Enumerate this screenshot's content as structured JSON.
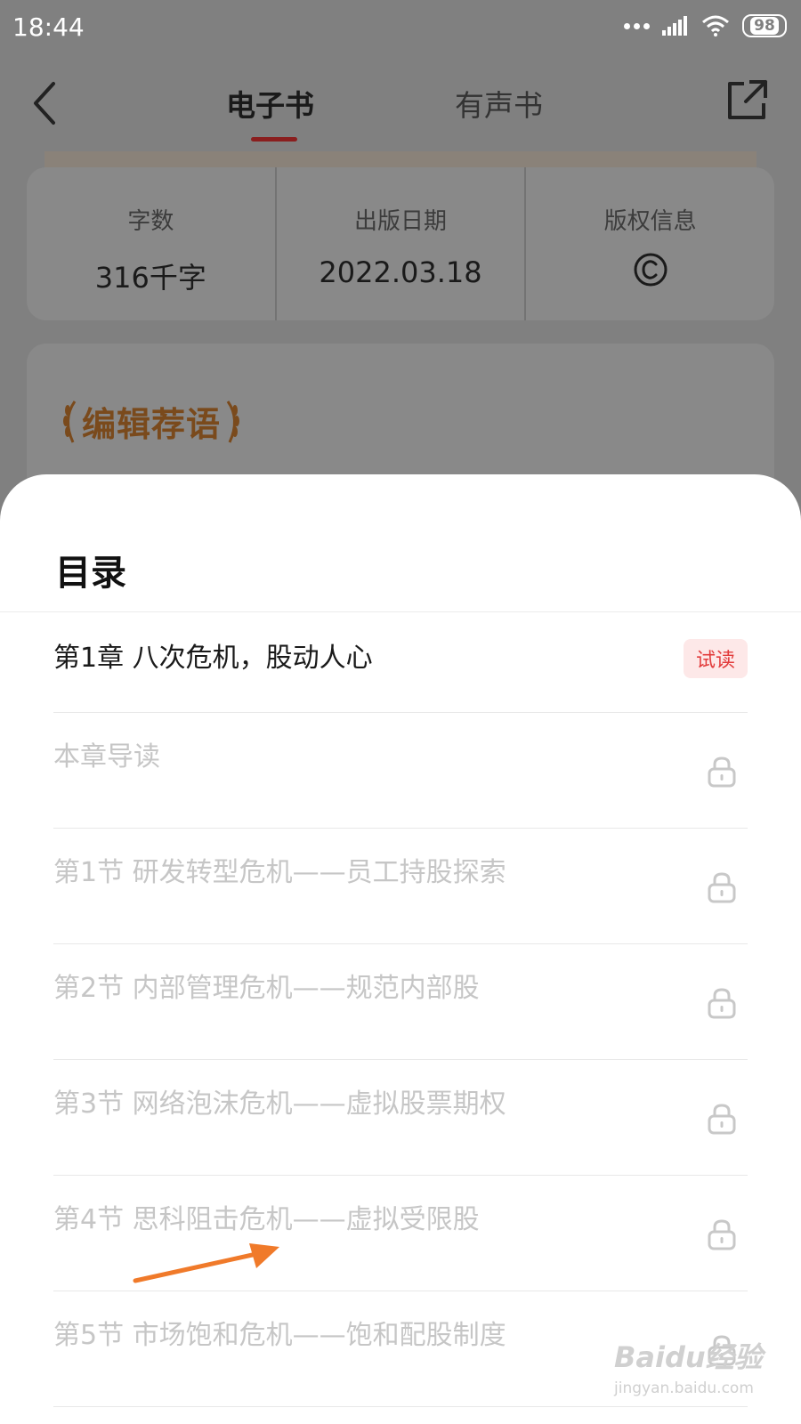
{
  "status_bar": {
    "time": "18:44",
    "battery": "98"
  },
  "nav": {
    "tabs": [
      "电子书",
      "有声书"
    ]
  },
  "info": [
    {
      "label": "字数",
      "value": "316千字"
    },
    {
      "label": "出版日期",
      "value": "2022.03.18"
    },
    {
      "label": "版权信息",
      "value": "©"
    }
  ],
  "recommend": {
    "title": "编辑荐语"
  },
  "toc": {
    "title": "目录",
    "chapter": {
      "label": "第1章 八次危机，股动人心",
      "badge": "试读"
    },
    "items": [
      "本章导读",
      "第1节 研发转型危机——员工持股探索",
      "第2节 内部管理危机——规范内部股",
      "第3节 网络泡沫危机——虚拟股票期权",
      "第4节 思科阻击危机——虚拟受限股",
      "第5节 市场饱和危机——饱和配股制度"
    ]
  },
  "watermark": {
    "logo": "Baidu经验",
    "url": "jingyan.baidu.com"
  },
  "colors": {
    "accent": "#e23b3b",
    "locked_text": "#c6c6c6",
    "annotation_arrow": "#f07a2a"
  }
}
